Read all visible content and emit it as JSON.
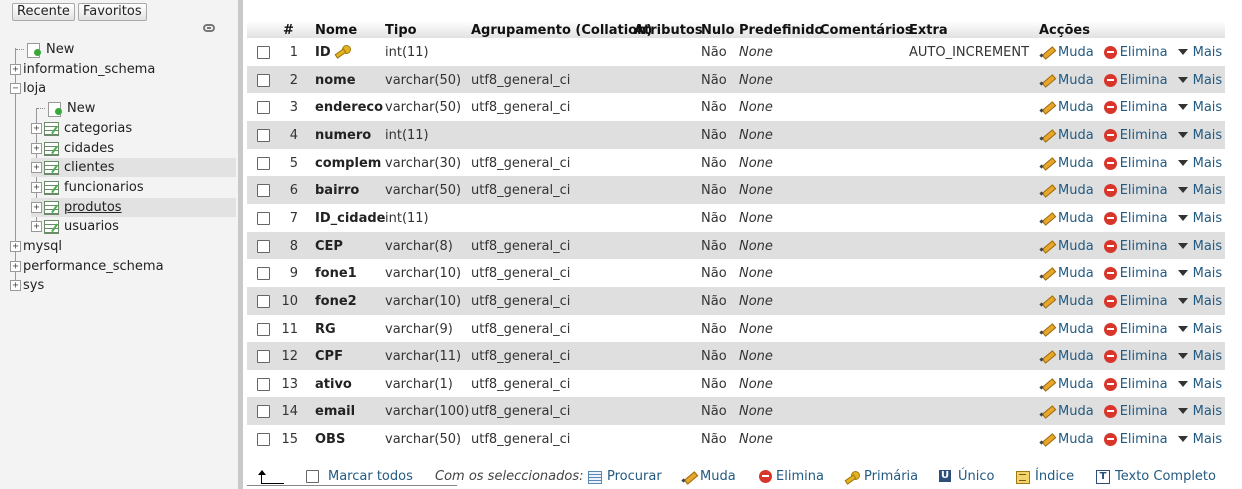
{
  "nav": {
    "tabs": [
      "Recente",
      "Favoritos"
    ],
    "tree": [
      {
        "label": "New",
        "kind": "new",
        "level": 0
      },
      {
        "label": "information_schema",
        "kind": "db",
        "level": 0
      },
      {
        "label": "loja",
        "kind": "db",
        "level": 0,
        "expanded": true
      },
      {
        "label": "New",
        "kind": "new",
        "level": 1
      },
      {
        "label": "categorias",
        "kind": "table",
        "level": 1
      },
      {
        "label": "cidades",
        "kind": "table",
        "level": 1
      },
      {
        "label": "clientes",
        "kind": "table",
        "level": 1,
        "selected": true
      },
      {
        "label": "funcionarios",
        "kind": "table",
        "level": 1
      },
      {
        "label": "produtos",
        "kind": "table",
        "level": 1,
        "hovered": true
      },
      {
        "label": "usuarios",
        "kind": "table",
        "level": 1
      },
      {
        "label": "mysql",
        "kind": "db",
        "level": 0
      },
      {
        "label": "performance_schema",
        "kind": "db",
        "level": 0
      },
      {
        "label": "sys",
        "kind": "db",
        "level": 0
      }
    ]
  },
  "table": {
    "headers": [
      "#",
      "Nome",
      "Tipo",
      "Agrupamento (Collation)",
      "Atributos",
      "Nulo",
      "Predefinido",
      "Comentários",
      "Extra",
      "Acções"
    ],
    "actions": {
      "change": "Muda",
      "drop": "Elimina",
      "more": "Mais"
    },
    "rows": [
      {
        "num": "1",
        "name": "ID",
        "type": "int(11)",
        "collation": "",
        "null": "Não",
        "default": "None",
        "extra": "AUTO_INCREMENT",
        "primary": true
      },
      {
        "num": "2",
        "name": "nome",
        "type": "varchar(50)",
        "collation": "utf8_general_ci",
        "null": "Não",
        "default": "None",
        "extra": ""
      },
      {
        "num": "3",
        "name": "endereco",
        "type": "varchar(50)",
        "collation": "utf8_general_ci",
        "null": "Não",
        "default": "None",
        "extra": ""
      },
      {
        "num": "4",
        "name": "numero",
        "type": "int(11)",
        "collation": "",
        "null": "Não",
        "default": "None",
        "extra": ""
      },
      {
        "num": "5",
        "name": "complem",
        "type": "varchar(30)",
        "collation": "utf8_general_ci",
        "null": "Não",
        "default": "None",
        "extra": ""
      },
      {
        "num": "6",
        "name": "bairro",
        "type": "varchar(50)",
        "collation": "utf8_general_ci",
        "null": "Não",
        "default": "None",
        "extra": ""
      },
      {
        "num": "7",
        "name": "ID_cidade",
        "type": "int(11)",
        "collation": "",
        "null": "Não",
        "default": "None",
        "extra": ""
      },
      {
        "num": "8",
        "name": "CEP",
        "type": "varchar(8)",
        "collation": "utf8_general_ci",
        "null": "Não",
        "default": "None",
        "extra": ""
      },
      {
        "num": "9",
        "name": "fone1",
        "type": "varchar(10)",
        "collation": "utf8_general_ci",
        "null": "Não",
        "default": "None",
        "extra": ""
      },
      {
        "num": "10",
        "name": "fone2",
        "type": "varchar(10)",
        "collation": "utf8_general_ci",
        "null": "Não",
        "default": "None",
        "extra": ""
      },
      {
        "num": "11",
        "name": "RG",
        "type": "varchar(9)",
        "collation": "utf8_general_ci",
        "null": "Não",
        "default": "None",
        "extra": ""
      },
      {
        "num": "12",
        "name": "CPF",
        "type": "varchar(11)",
        "collation": "utf8_general_ci",
        "null": "Não",
        "default": "None",
        "extra": ""
      },
      {
        "num": "13",
        "name": "ativo",
        "type": "varchar(1)",
        "collation": "utf8_general_ci",
        "null": "Não",
        "default": "None",
        "extra": ""
      },
      {
        "num": "14",
        "name": "email",
        "type": "varchar(100)",
        "collation": "utf8_general_ci",
        "null": "Não",
        "default": "None",
        "extra": ""
      },
      {
        "num": "15",
        "name": "OBS",
        "type": "varchar(50)",
        "collation": "utf8_general_ci",
        "null": "Não",
        "default": "None",
        "extra": ""
      }
    ]
  },
  "footer": {
    "check_all": "Marcar todos",
    "with_selected": "Com os seleccionados:",
    "actions": [
      "Procurar",
      "Muda",
      "Elimina",
      "Primária",
      "Único",
      "Índice",
      "Texto Completo"
    ]
  },
  "colors": {
    "link": "#235a81",
    "row_alt": "#dfdfdf",
    "nav_bg": "#f3f3f3"
  }
}
